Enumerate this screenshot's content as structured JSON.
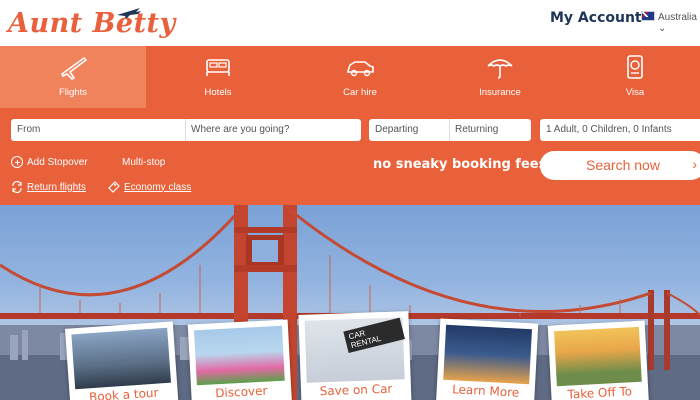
{
  "header": {
    "logo_text": "Aunt Betty",
    "account_label": "My Account",
    "country_label": "Australia"
  },
  "tabs": [
    {
      "label": "Flights",
      "icon": "plane-icon",
      "active": true
    },
    {
      "label": "Hotels",
      "icon": "bed-icon",
      "active": false
    },
    {
      "label": "Car hire",
      "icon": "car-icon",
      "active": false
    },
    {
      "label": "Insurance",
      "icon": "umbrella-icon",
      "active": false
    },
    {
      "label": "Visa",
      "icon": "passport-icon",
      "active": false
    }
  ],
  "search_form": {
    "from_placeholder": "From",
    "to_placeholder": "Where are you going?",
    "departing_label": "Departing",
    "returning_label": "Returning",
    "passengers_label": "1 Adult, 0 Children, 0 Infants",
    "add_stopover_label": "Add Stopover",
    "multi_stop_label": "Multi-stop",
    "return_flights_label": "Return flights",
    "economy_class_label": "Economy class",
    "tagline": "no sneaky booking fees!",
    "search_button_label": "Search now"
  },
  "hero": {
    "postcards": [
      {
        "caption": "Book a tour"
      },
      {
        "caption": "Discover"
      },
      {
        "caption": "Save on Car"
      },
      {
        "caption": "Learn More"
      },
      {
        "caption": "Take Off To"
      }
    ],
    "car_rental_sign": "CAR RENTAL"
  },
  "colors": {
    "brand_orange": "#e8613a",
    "active_tab": "#f0825c",
    "account_text": "#1d3557"
  }
}
